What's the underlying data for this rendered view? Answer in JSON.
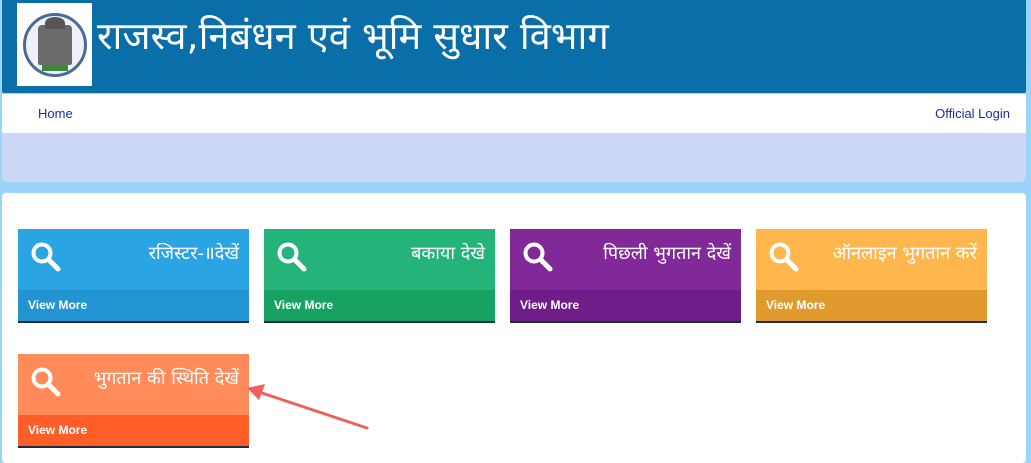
{
  "header": {
    "title": "राजस्व,निबंधन एवं भूमि सुधार विभाग",
    "logo_icon": "state-emblem-icon",
    "background": "#0a6ea8"
  },
  "nav": {
    "home": "Home",
    "official_login": "Official Login"
  },
  "tiles": [
    {
      "title": "रजिस्टर-॥देखें",
      "more": "View More",
      "icon": "search-icon",
      "top_color": "#2aa4e2",
      "bottom_color": "#2294d2"
    },
    {
      "title": "बकाया देखे",
      "more": "View More",
      "icon": "search-icon",
      "top_color": "#24b47a",
      "bottom_color": "#17a263"
    },
    {
      "title": "पिछली भुगतान देखें",
      "more": "View More",
      "icon": "search-icon",
      "top_color": "#82299a",
      "bottom_color": "#6f1d88"
    },
    {
      "title": "ऑनलाइन भुगतान करें",
      "more": "View More",
      "icon": "search-icon",
      "top_color": "#ffb64c",
      "bottom_color": "#e19a2e"
    },
    {
      "title": "भुगतान की स्थिति देखें",
      "more": "View More",
      "icon": "search-icon",
      "top_color": "#ff8a5a",
      "bottom_color": "#ff5e28"
    }
  ],
  "annotation": {
    "arrow_color": "#f0605a"
  }
}
